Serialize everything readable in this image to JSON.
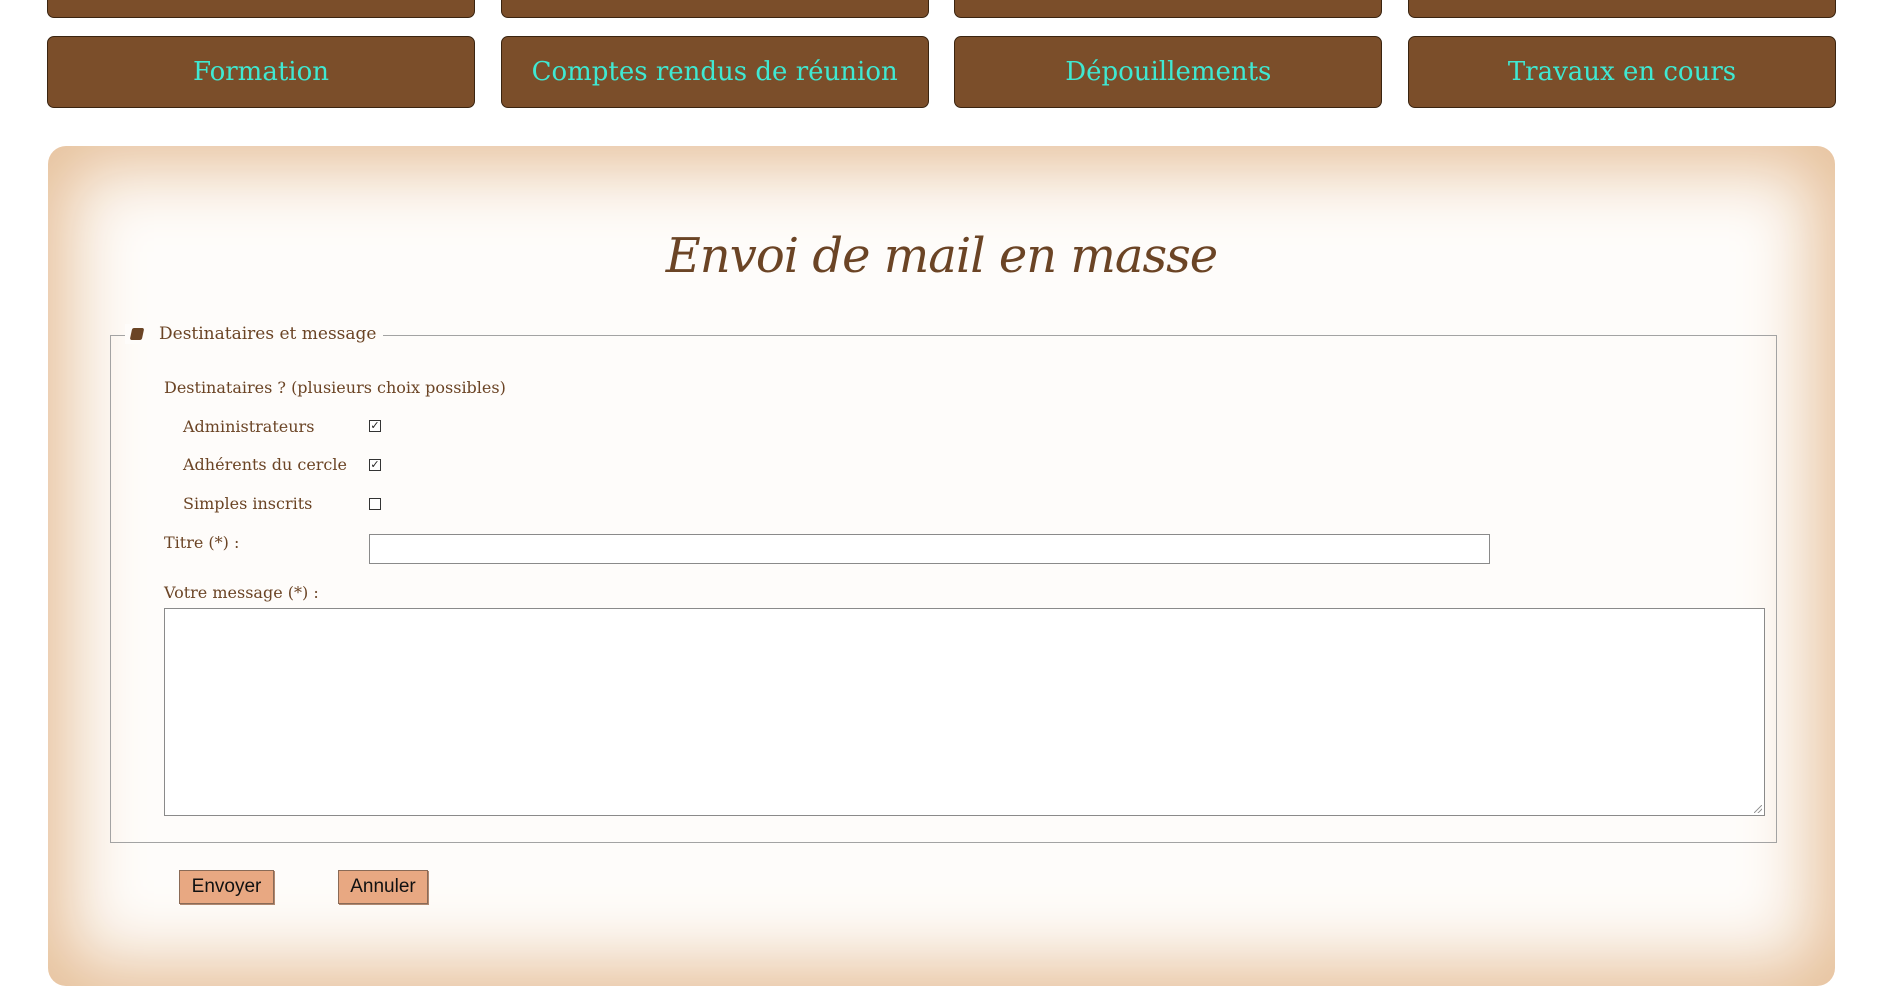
{
  "nav": {
    "top_row": [
      "",
      "",
      "",
      ""
    ],
    "main_row": [
      "Formation",
      "Comptes rendus de réunion",
      "Dépouillements",
      "Travaux en cours"
    ]
  },
  "page": {
    "title": "Envoi de mail en masse"
  },
  "form": {
    "legend": "Destinataires et message",
    "legend_icon": "book-icon",
    "recipients_label": "Destinataires ? (plusieurs choix possibles)",
    "recipients": [
      {
        "label": "Administrateurs",
        "checked": true
      },
      {
        "label": "Adhérents du cercle",
        "checked": true
      },
      {
        "label": "Simples inscrits",
        "checked": false
      }
    ],
    "title_label": "Titre (*) :",
    "title_value": "",
    "message_label": "Votre message (*) :",
    "message_value": "",
    "submit_label": "Envoyer",
    "cancel_label": "Annuler"
  },
  "colors": {
    "nav_bg": "#7b4e2a",
    "nav_text": "#3fe8d2",
    "panel_glow": "#e6c09a",
    "text_brown": "#6b4425",
    "button_bg": "#e8a882"
  }
}
